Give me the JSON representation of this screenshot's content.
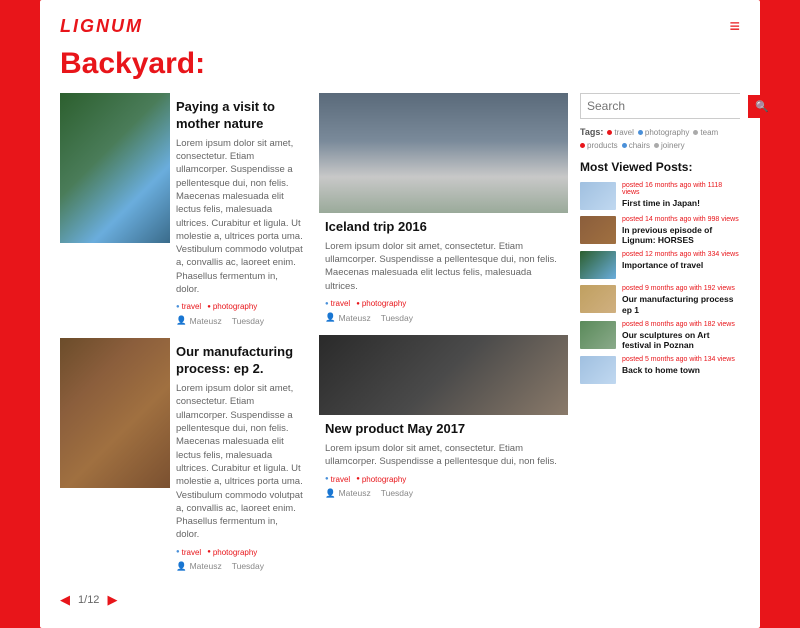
{
  "logo": "LIGNUM",
  "page_title": "Backyard:",
  "search": {
    "placeholder": "Search",
    "btn_icon": "🔍"
  },
  "tags_label": "Tags:",
  "tags": [
    {
      "label": "travel",
      "color": "red"
    },
    {
      "label": "photography",
      "color": "blue"
    },
    {
      "label": "team",
      "color": "gray"
    },
    {
      "label": "products",
      "color": "red"
    },
    {
      "label": "chairs",
      "color": "blue"
    },
    {
      "label": "joinery",
      "color": "gray"
    }
  ],
  "most_viewed_title": "Most Viewed Posts:",
  "most_viewed": [
    {
      "meta": "posted 16 months ago with 1118 views",
      "title": "First time in Japan!",
      "thumb_class": "mv-thumb-1"
    },
    {
      "meta": "posted 14 months ago with 998 views",
      "title": "In previous episode of Lignum: HORSES",
      "thumb_class": "mv-thumb-2"
    },
    {
      "meta": "posted 12 months ago with 334 views",
      "title": "Importance of travel",
      "thumb_class": "mv-thumb-3"
    },
    {
      "meta": "posted 9 months ago with 192 views",
      "title": "Our manufacturing process ep 1",
      "thumb_class": "mv-thumb-4"
    },
    {
      "meta": "posted 8 months ago with 182 views",
      "title": "Our sculptures on Art festival in Poznan",
      "thumb_class": "mv-thumb-5"
    },
    {
      "meta": "posted 5 months ago with 134 views",
      "title": "Back to home town",
      "thumb_class": "mv-thumb-1"
    }
  ],
  "articles_col1": [
    {
      "title": "Paying a visit to mother nature",
      "excerpt": "Lorem ipsum dolor sit amet, consectetur. Etiam ullamcorper. Suspendisse a pellentesque dui, non felis. Maecenas malesuada elit lectus felis, malesuada ultrices. Curabitur et ligula. Ut molestie a, ultrices porta uma. Vestibulum commodo volutpat a, convallis ac, laoreet enim. Phasellus fermentum in, dolor.",
      "tag1": "travel",
      "tag2": "photography",
      "author": "Mateusz",
      "date": "Tuesday",
      "img_class": "img-waterfall"
    },
    {
      "title": "Our manufacturing process: ep 2.",
      "excerpt": "Lorem ipsum dolor sit amet, consectetur. Etiam ullamcorper. Suspendisse a pellentesque dui, non felis. Maecenas malesuada elit lectus felis, malesuada ultrices. Curabitur et ligula. Ut molestie a, ultrices porta uma. Vestibulum commodo volutpat a, convallis ac, laoreet enim. Phasellus fermentum in, dolor.",
      "tag1": "travel",
      "tag2": "photography",
      "author": "Mateusz",
      "date": "Tuesday",
      "img_class": "img-logs"
    }
  ],
  "articles_col2": [
    {
      "title": "Iceland trip 2016",
      "excerpt": "Lorem ipsum dolor sit amet, consectetur. Etiam ullamcorper. Suspendisse a pellentesque dui, non felis. Maecenas malesuada elit lectus felis, malesuada ultrices.",
      "tag1": "travel",
      "tag2": "photography",
      "author": "Mateusz",
      "date": "Tuesday",
      "img_class": "img-jeep"
    },
    {
      "title": "New product May 2017",
      "excerpt": "Lorem ipsum dolor sit amet, consectetur. Etiam ullamcorper. Suspendisse a pellentesque dui, non felis.",
      "tag1": "travel",
      "tag2": "photography",
      "author": "Mateusz",
      "date": "Tuesday",
      "img_class": "img-table"
    }
  ],
  "pagination": {
    "current": "1",
    "total": "12"
  }
}
